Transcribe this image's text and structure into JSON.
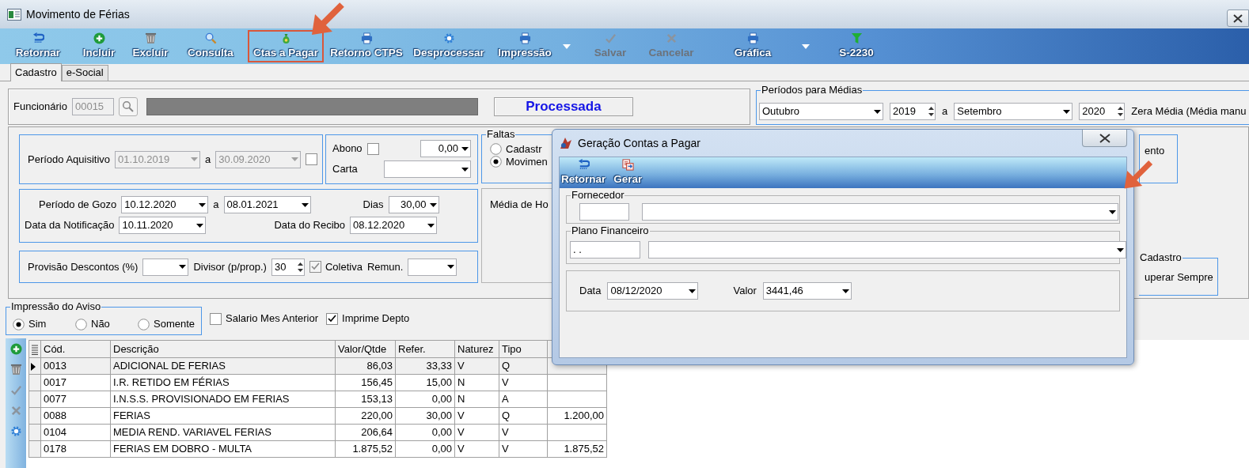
{
  "window": {
    "title": "Movimento de Férias"
  },
  "toolbar": [
    {
      "label": "Retornar",
      "kind": "return",
      "disabled": false,
      "highlighted": false,
      "dropdown": false
    },
    {
      "label": "Incluir",
      "kind": "plus",
      "disabled": false,
      "highlighted": false,
      "dropdown": false
    },
    {
      "label": "Excluir",
      "kind": "trash",
      "disabled": false,
      "highlighted": false,
      "dropdown": false
    },
    {
      "label": "Consulta",
      "kind": "search",
      "disabled": false,
      "highlighted": false,
      "dropdown": false
    },
    {
      "label": "Ctas a Pagar",
      "kind": "money",
      "disabled": false,
      "highlighted": true,
      "dropdown": false
    },
    {
      "label": "Retorno CTPS",
      "kind": "printer",
      "disabled": false,
      "highlighted": false,
      "dropdown": false
    },
    {
      "label": "Desprocessar",
      "kind": "gear",
      "disabled": false,
      "highlighted": false,
      "dropdown": false
    },
    {
      "label": "Impressão",
      "kind": "printer",
      "disabled": false,
      "highlighted": false,
      "dropdown": true
    },
    {
      "label": "Salvar",
      "kind": "check",
      "disabled": true,
      "highlighted": false,
      "dropdown": false
    },
    {
      "label": "Cancelar",
      "kind": "cross",
      "disabled": true,
      "highlighted": false,
      "dropdown": false
    },
    {
      "label": "Gráfica",
      "kind": "printer",
      "disabled": false,
      "highlighted": false,
      "dropdown": true
    },
    {
      "label": "S-2230",
      "kind": "funnel",
      "disabled": false,
      "highlighted": false,
      "dropdown": false
    }
  ],
  "tabs": [
    {
      "label": "Cadastro",
      "selected": true
    },
    {
      "label": "e-Social",
      "selected": false
    }
  ],
  "employee": {
    "label": "Funcionário",
    "code": "00015",
    "status": "Processada"
  },
  "averages_period": {
    "title": "Períodos para Médias",
    "from_month": "Outubro",
    "from_year": "2019",
    "separator": "a",
    "to_month": "Setembro",
    "to_year": "2020",
    "zero_label": "Zera Média (Média manu"
  },
  "acquisition": {
    "label": "Período Aquisitivo",
    "from": "01.10.2019",
    "separator": "a",
    "to": "30.09.2020",
    "checked": false
  },
  "bonus": {
    "label": "Abono",
    "checked": false,
    "value": "0,00",
    "letter_label": "Carta"
  },
  "absences": {
    "title": "Faltas",
    "options": [
      {
        "label": "Cadastr",
        "selected": false
      },
      {
        "label": "Movimen",
        "selected": true
      }
    ]
  },
  "enjoyment": {
    "label": "Período de Gozo",
    "from": "10.12.2020",
    "separator": "a",
    "to": "08.01.2021",
    "days_label": "Dias",
    "days": "30,00",
    "notice_label": "Data da Notificação",
    "notice": "10.11.2020",
    "receipt_label": "Data do Recibo",
    "receipt": "08.12.2020"
  },
  "average_hours": {
    "label": "Média de Ho"
  },
  "provision": {
    "label": "Provisão Descontos (%)",
    "divisor_label": "Divisor (p/prop.)",
    "divisor": "30",
    "collective_label": "Coletiva",
    "collective": true,
    "remun_label": "Remun."
  },
  "right_fragments": {
    "box_text": "ento",
    "group_title": "Cadastro",
    "group_text": "uperar Sempre"
  },
  "notice_print": {
    "title": "Impressão do Aviso",
    "options": [
      {
        "label": "Sim",
        "selected": true
      },
      {
        "label": "Não",
        "selected": false
      },
      {
        "label": "Somente",
        "selected": false
      }
    ]
  },
  "checks": [
    {
      "label": "Salario Mes Anterior",
      "checked": false
    },
    {
      "label": "Imprime Depto",
      "checked": true
    }
  ],
  "table": {
    "columns": [
      "Cód.",
      "Descrição",
      "Valor/Qtde",
      "Refer.",
      "Naturez",
      "Tipo"
    ],
    "rows": [
      {
        "selected": true,
        "cells": [
          "0013",
          "ADICIONAL DE FERIAS",
          "86,03",
          "33,33",
          "V",
          "Q"
        ]
      },
      {
        "selected": false,
        "cells": [
          "0017",
          "I.R. RETIDO EM FÉRIAS",
          "156,45",
          "15,00",
          "N",
          "V"
        ]
      },
      {
        "selected": false,
        "cells": [
          "0077",
          "I.N.S.S. PROVISIONADO EM FERIAS",
          "153,13",
          "0,00",
          "N",
          "A"
        ]
      },
      {
        "selected": false,
        "cells": [
          "0088",
          "FERIAS",
          "220,00",
          "30,00",
          "V",
          "Q"
        ],
        "column_7": "1.200,00"
      },
      {
        "selected": false,
        "cells": [
          "0104",
          "MEDIA REND. VARIAVEL  FERIAS",
          "206,64",
          "0,00",
          "V",
          "V"
        ]
      },
      {
        "selected": false,
        "cells": [
          "0178",
          "FERIAS EM DOBRO - MULTA",
          "1.875,52",
          "0,00",
          "V",
          "V"
        ],
        "column_7": "1.875,52"
      }
    ]
  },
  "dialog": {
    "title": "Geração Contas a Pagar",
    "toolbar": [
      {
        "label": "Retornar",
        "kind": "return"
      },
      {
        "label": "Gerar",
        "kind": "generate"
      }
    ],
    "supplier": {
      "title": "Fornecedor"
    },
    "plan": {
      "title": "Plano Financeiro",
      "code": ". ."
    },
    "date_label": "Data",
    "date": "08/12/2020",
    "value_label": "Valor",
    "value": "3441,46"
  }
}
